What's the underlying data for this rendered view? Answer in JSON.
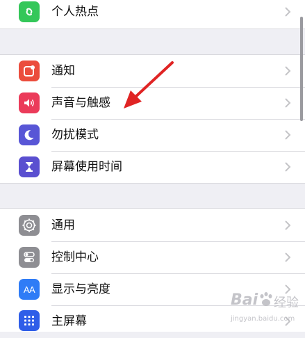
{
  "colors": {
    "background": "#efeff4",
    "cell": "#ffffff",
    "separator": "#d9d9de",
    "annotation_arrow": "#e02424"
  },
  "groups": [
    {
      "items": [
        {
          "label": "个人热点",
          "icon": "hotspot-chain-icon",
          "icon_bg": "#34c759"
        }
      ]
    },
    {
      "items": [
        {
          "label": "通知",
          "icon": "notifications-icon",
          "icon_bg": "#eb4d3d"
        },
        {
          "label": "声音与触感",
          "icon": "speaker-icon",
          "icon_bg": "#eb3b5a"
        },
        {
          "label": "勿扰模式",
          "icon": "moon-icon",
          "icon_bg": "#5856d6"
        },
        {
          "label": "屏幕使用时间",
          "icon": "hourglass-icon",
          "icon_bg": "#5a4fd0"
        }
      ]
    },
    {
      "items": [
        {
          "label": "通用",
          "icon": "gear-icon",
          "icon_bg": "#8e8e93"
        },
        {
          "label": "控制中心",
          "icon": "toggles-icon",
          "icon_bg": "#8e8e93"
        },
        {
          "label": "显示与亮度",
          "icon": "text-size-icon",
          "icon_bg": "#2f7cf6",
          "icon_text": "AA"
        },
        {
          "label": "主屏幕",
          "icon": "home-screen-icon",
          "icon_bg": "#2f5ee8"
        }
      ]
    }
  ],
  "watermark": {
    "brand": "Bai",
    "brand2": "经验",
    "url": "jingyan.baidu.com"
  }
}
